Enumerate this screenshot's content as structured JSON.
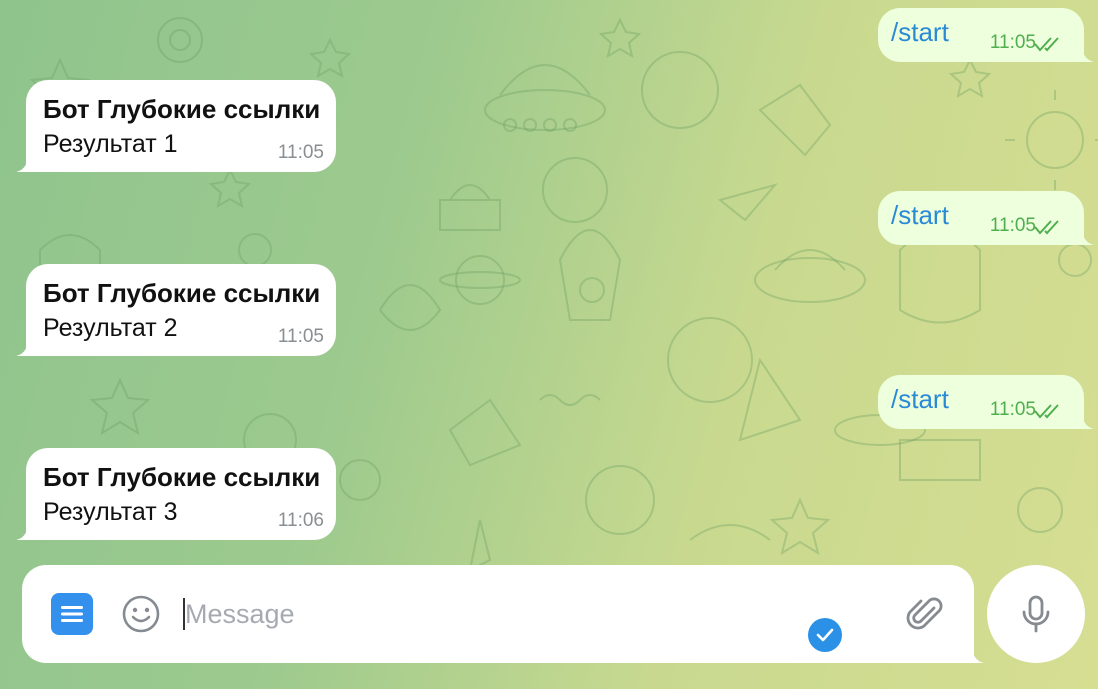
{
  "theme": {
    "accent": "#3390ec",
    "incoming_bubble": "#ffffff",
    "outgoing_bubble": "#eeffde",
    "command_link_color": "#2a8ad6",
    "read_check_color": "#4fae4e"
  },
  "messages": [
    {
      "direction": "out",
      "text": "/start",
      "time": "11:05",
      "status": "read"
    },
    {
      "direction": "in",
      "sender": "Бот Глубокие ссылки",
      "text": "Результат 1",
      "time": "11:05"
    },
    {
      "direction": "out",
      "text": "/start",
      "time": "11:05",
      "status": "read"
    },
    {
      "direction": "in",
      "sender": "Бот Глубокие ссылки",
      "text": "Результат 2",
      "time": "11:05"
    },
    {
      "direction": "out",
      "text": "/start",
      "time": "11:05",
      "status": "read"
    },
    {
      "direction": "in",
      "sender": "Бот Глубокие ссылки",
      "text": "Результат 3",
      "time": "11:06"
    }
  ],
  "composer": {
    "placeholder": "Message",
    "value": "",
    "icons": {
      "menu": "bot-menu-icon",
      "emoji": "emoji-icon",
      "status": "checkmark-badge-icon",
      "attach": "paperclip-icon",
      "voice": "microphone-icon"
    }
  }
}
